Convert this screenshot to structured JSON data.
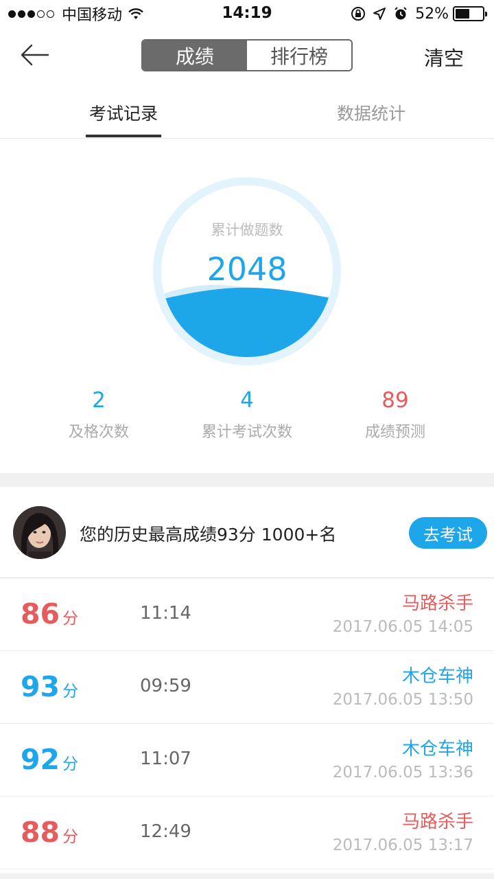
{
  "status_bar": {
    "carrier": "中国移动",
    "time": "14:19",
    "battery": "52%",
    "battery_level": 0.52
  },
  "nav": {
    "segments": [
      "成绩",
      "排行榜"
    ],
    "active_segment": "成绩",
    "clear_label": "清空"
  },
  "sub_tabs": {
    "items": [
      "考试记录",
      "数据统计"
    ],
    "active": "考试记录"
  },
  "summary": {
    "circle_label": "累计做题数",
    "circle_value": "2048",
    "stats": [
      {
        "value": "2",
        "label": "及格次数",
        "color": "#1ea6ea"
      },
      {
        "value": "4",
        "label": "累计考试次数",
        "color": "#1ea6ea"
      },
      {
        "value": "89",
        "label": "成绩预测",
        "color": "#e65c5c"
      }
    ]
  },
  "best": {
    "text": "您的历史最高成绩93分 1000+名",
    "button_label": "去考试"
  },
  "records": [
    {
      "score": "86",
      "unit": "分",
      "duration": "11:14",
      "title": "马路杀手",
      "date": "2017.06.05 14:05",
      "color": "#e65c5c"
    },
    {
      "score": "93",
      "unit": "分",
      "duration": "09:59",
      "title": "木仓车神",
      "date": "2017.06.05 13:50",
      "color": "#1ea6ea"
    },
    {
      "score": "92",
      "unit": "分",
      "duration": "11:07",
      "title": "木仓车神",
      "date": "2017.06.05 13:36",
      "color": "#1ea6ea"
    },
    {
      "score": "88",
      "unit": "分",
      "duration": "12:49",
      "title": "马路杀手",
      "date": "2017.06.05 13:17",
      "color": "#e65c5c"
    }
  ],
  "colors": {
    "accent": "#1ea6ea",
    "fail": "#e65c5c"
  }
}
